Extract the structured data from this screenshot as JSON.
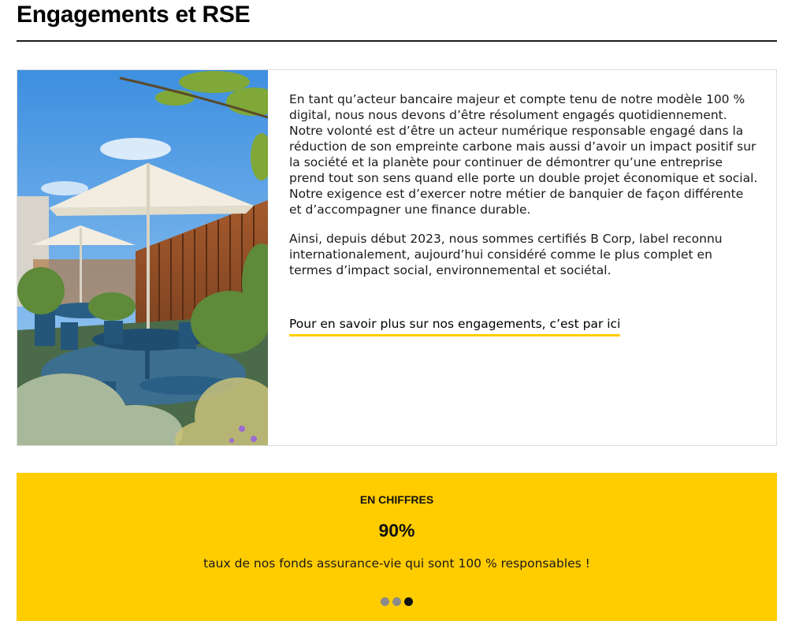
{
  "section": {
    "title": "Engagements et RSE"
  },
  "card": {
    "photo_alt": "terrasse-jardin",
    "paragraphs": [
      "En tant qu’acteur bancaire majeur et compte tenu de notre modèle 100 % digital, nous nous devons d’être résolument engagés quotidiennement. Notre volonté est d’être un acteur numérique responsable engagé dans la réduction de son empreinte carbone mais aussi d’avoir un impact positif sur la société et la planète pour continuer de démontrer qu’une entreprise prend tout son sens quand elle porte un double projet économique et social. Notre exigence est d’exercer notre métier de banquier de façon différente et d’accompagner une finance durable.",
      "Ainsi, depuis début 2023, nous sommes certifiés B Corp, label reconnu internationalement, aujourd’hui considéré comme le plus complet en termes d’impact social, environnemental et sociétal."
    ],
    "link_label": "Pour en savoir plus sur nos engagements, c’est par ici"
  },
  "stats": {
    "eyebrow": "EN CHIFFRES",
    "value": "90%",
    "caption": "taux de nos fonds assurance-vie qui sont 100 % responsables !",
    "slides_total": 3,
    "active_slide": 3
  },
  "colors": {
    "accent": "#ffcc00",
    "text": "#1a1a1a",
    "dot_inactive": "#8a8a8a",
    "dot_active": "#111111"
  }
}
